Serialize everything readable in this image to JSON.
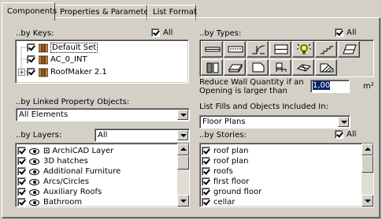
{
  "tabs": [
    {
      "label": "Components"
    },
    {
      "label": "Properties & Parameters"
    },
    {
      "label": "List Format"
    }
  ],
  "by_keys": {
    "label": "..by Keys:",
    "all_label": "All",
    "items": [
      {
        "label": "Default Set"
      },
      {
        "label": "AC_0_INT"
      },
      {
        "label": "RoofMaker 2.1"
      }
    ]
  },
  "by_types": {
    "label": "..by Types:",
    "all_label": "All",
    "reduce_label_line1": "Reduce Wall Quantity if an",
    "reduce_label_line2": "Opening is larger than",
    "reduce_value": "1,00",
    "reduce_unit": "m²"
  },
  "linked": {
    "label": "..by Linked Property Objects:",
    "value": "All Elements"
  },
  "list_fills": {
    "label": "List Fills and Objects Included In:",
    "value": "Floor Plans"
  },
  "by_layers": {
    "label": "..by Layers:",
    "filter_value": "All",
    "items": [
      {
        "label": "ArchiCAD Layer"
      },
      {
        "label": "3D hatches"
      },
      {
        "label": "Additional Furniture"
      },
      {
        "label": "Arcs/Circles"
      },
      {
        "label": "Auxiliary Roofs"
      },
      {
        "label": "Bathroom"
      }
    ]
  },
  "by_stories": {
    "label": "..by Stories:",
    "all_label": "All",
    "items": [
      {
        "label": "roof plan"
      },
      {
        "label": "roof plan"
      },
      {
        "label": "roofs"
      },
      {
        "label": "first floor"
      },
      {
        "label": "ground floor"
      },
      {
        "label": "cellar"
      }
    ]
  }
}
